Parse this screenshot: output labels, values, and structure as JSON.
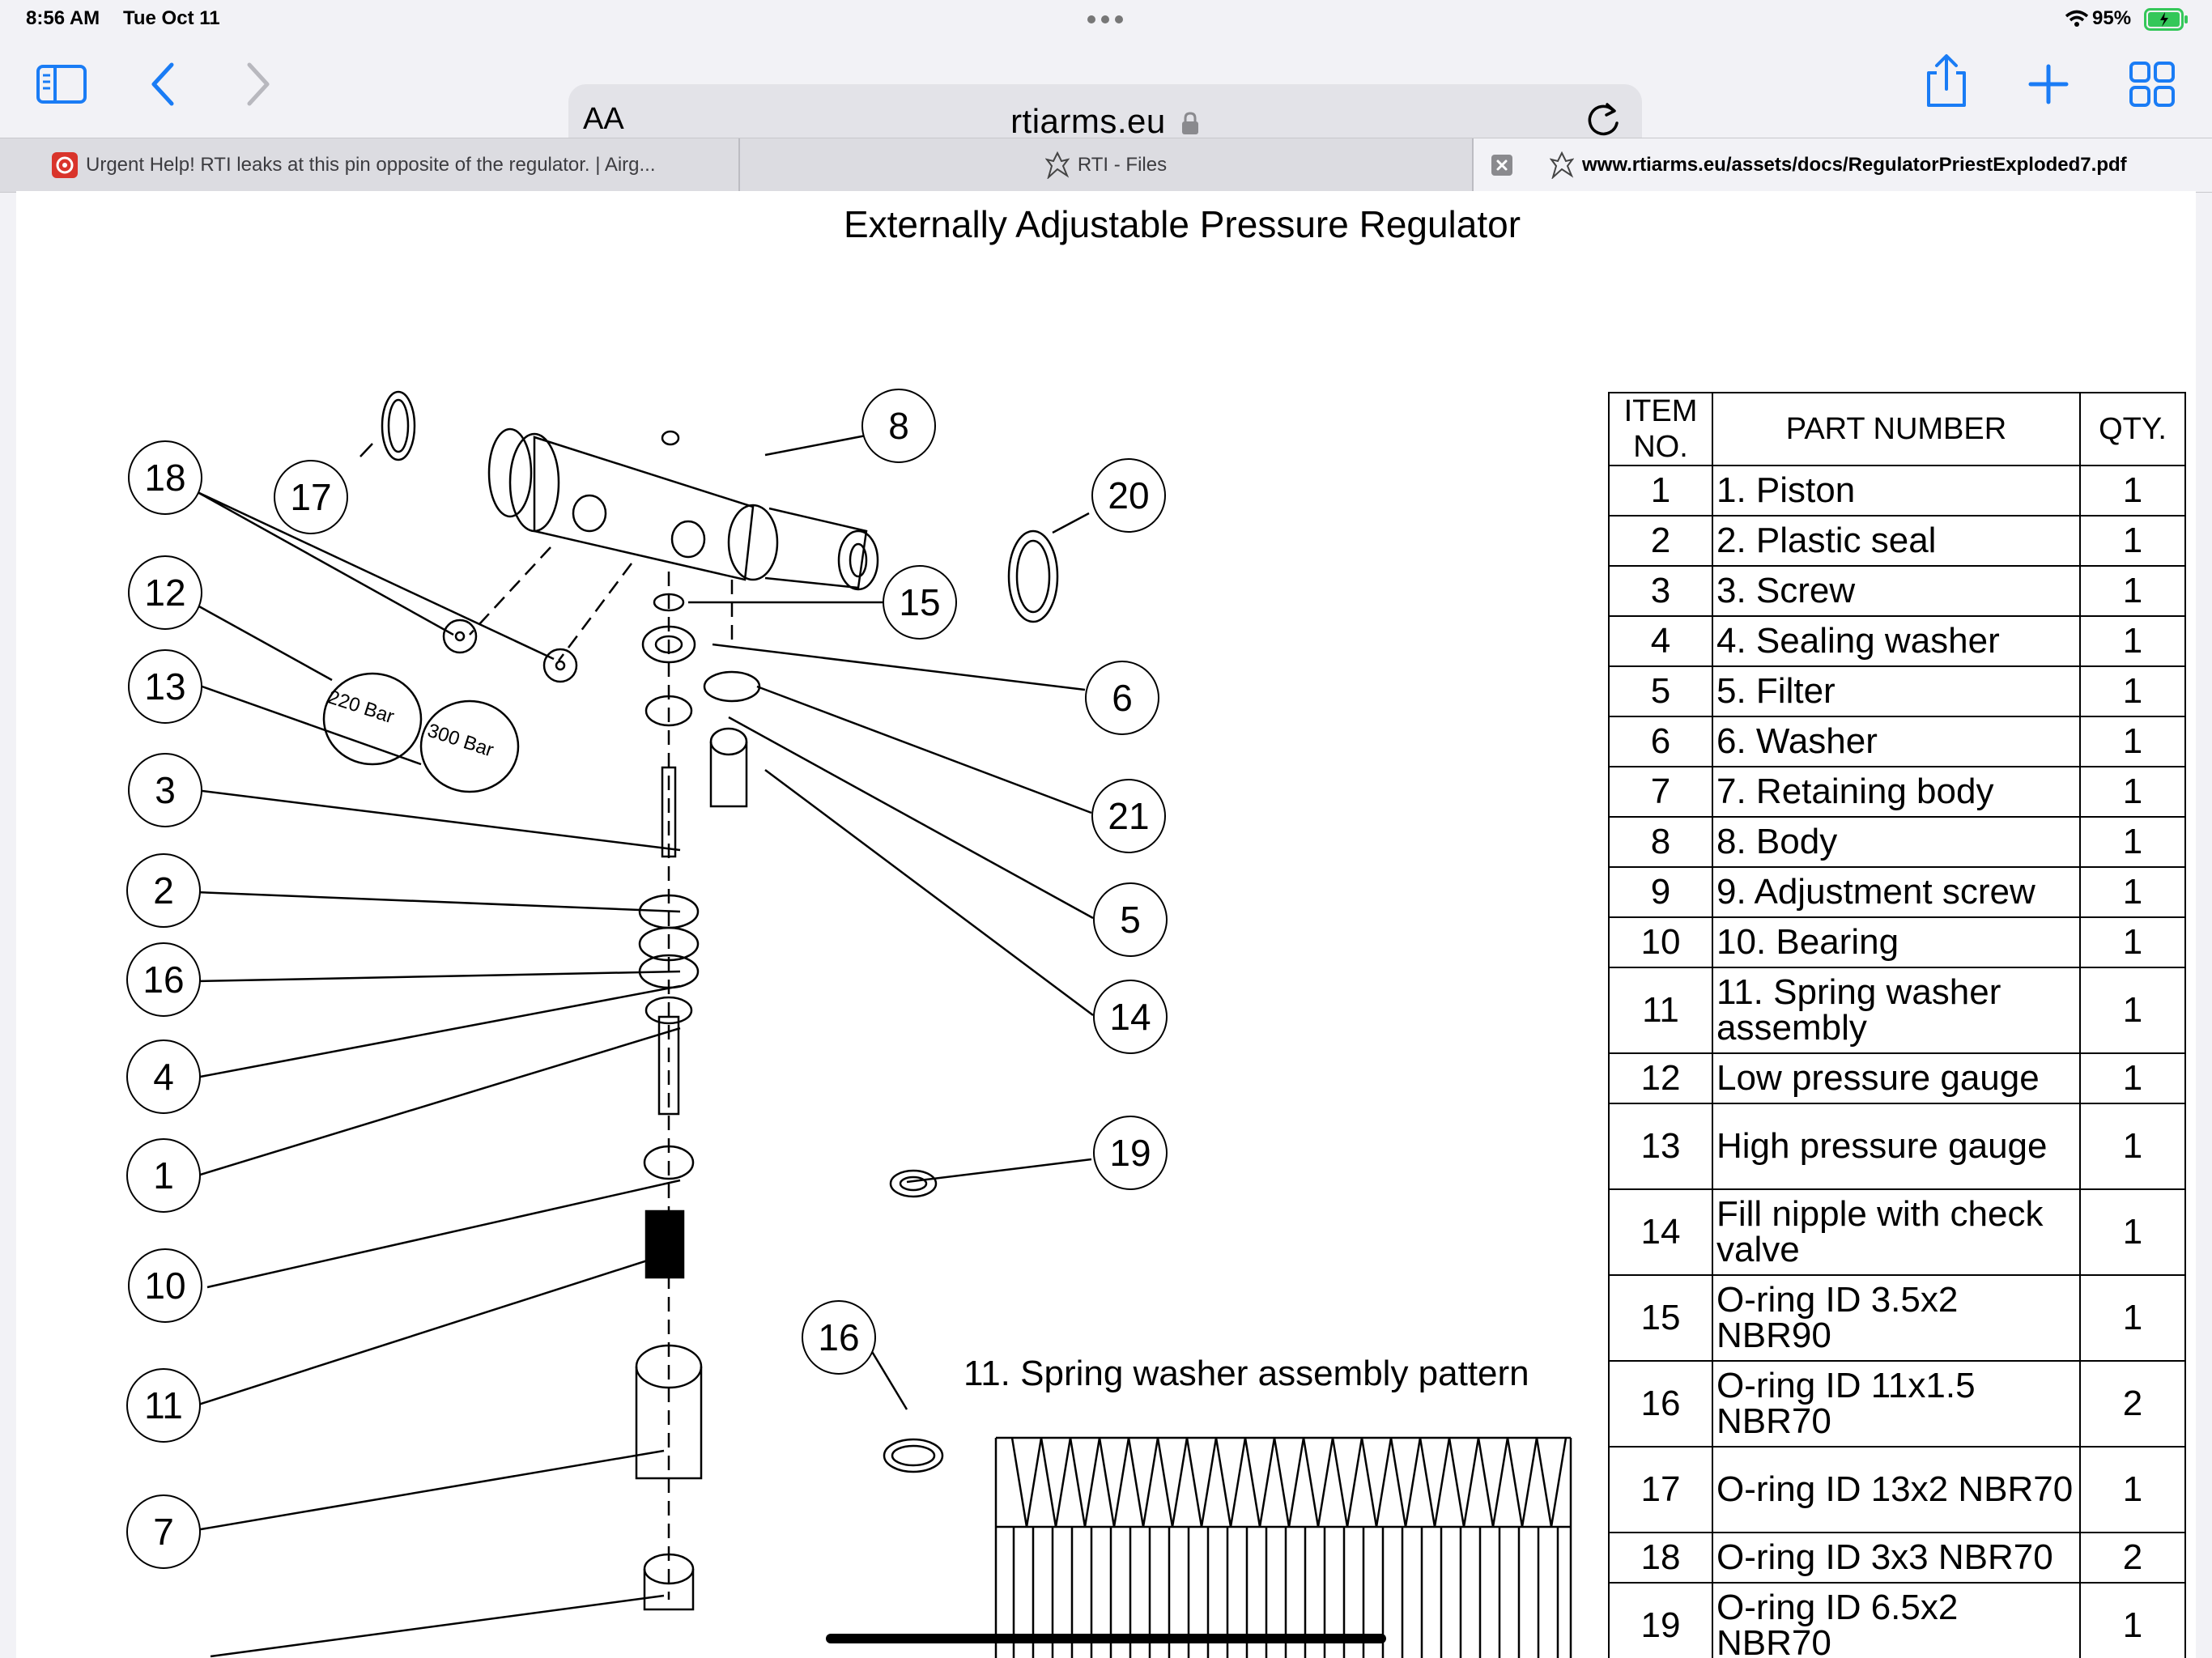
{
  "status_bar": {
    "time": "8:56 AM",
    "date": "Tue Oct 11",
    "battery": "95%"
  },
  "toolbar": {
    "text_size_label": "AA",
    "url": "rtiarms.eu"
  },
  "tabs": [
    {
      "label": "Urgent Help! RTI leaks at this pin opposite of the regulator. | Airg..."
    },
    {
      "label": "RTI - Files"
    },
    {
      "label": "www.rtiarms.eu/assets/docs/RegulatorPriestExploded7.pdf"
    }
  ],
  "document": {
    "title": "Externally Adjustable Pressure Regulator",
    "pattern_title": "11. Spring washer assembly pattern",
    "gauge_labels": [
      "220 Bar",
      "300 Bar"
    ],
    "callouts": [
      "18",
      "17",
      "8",
      "20",
      "12",
      "15",
      "13",
      "6",
      "3",
      "21",
      "2",
      "5",
      "16",
      "14",
      "4",
      "1",
      "19",
      "10",
      "16",
      "11",
      "7"
    ],
    "table": {
      "headers": {
        "item_no": "ITEM NO.",
        "part_number": "PART NUMBER",
        "qty": "QTY."
      },
      "rows": [
        {
          "item": "1",
          "part": "1. Piston",
          "qty": "1"
        },
        {
          "item": "2",
          "part": "2. Plastic seal",
          "qty": "1"
        },
        {
          "item": "3",
          "part": "3. Screw",
          "qty": "1"
        },
        {
          "item": "4",
          "part": "4. Sealing washer",
          "qty": "1"
        },
        {
          "item": "5",
          "part": "5. Filter",
          "qty": "1"
        },
        {
          "item": "6",
          "part": "6. Washer",
          "qty": "1"
        },
        {
          "item": "7",
          "part": "7. Retaining body",
          "qty": "1"
        },
        {
          "item": "8",
          "part": "8. Body",
          "qty": "1"
        },
        {
          "item": "9",
          "part": "9. Adjustment screw",
          "qty": "1"
        },
        {
          "item": "10",
          "part": "10. Bearing",
          "qty": "1"
        },
        {
          "item": "11",
          "part": "11. Spring washer assembly",
          "qty": "1"
        },
        {
          "item": "12",
          "part": "Low pressure gauge",
          "qty": "1"
        },
        {
          "item": "13",
          "part": "High pressure gauge",
          "qty": "1"
        },
        {
          "item": "14",
          "part": "Fill nipple with check valve",
          "qty": "1"
        },
        {
          "item": "15",
          "part": "O-ring ID 3.5x2 NBR90",
          "qty": "1"
        },
        {
          "item": "16",
          "part": "O-ring ID 11x1.5 NBR70",
          "qty": "2"
        },
        {
          "item": "17",
          "part": "O-ring ID 13x2 NBR70",
          "qty": "1"
        },
        {
          "item": "18",
          "part": "O-ring ID 3x3 NBR70",
          "qty": "2"
        },
        {
          "item": "19",
          "part": "O-ring ID 6.5x2 NBR70",
          "qty": "1"
        }
      ]
    }
  },
  "icons": {
    "sidebar": "sidebar-icon",
    "back": "chevron-left-icon",
    "forward": "chevron-right-icon",
    "lock": "lock-icon",
    "reload": "reload-icon",
    "share": "share-icon",
    "new_tab": "plus-icon",
    "tab_overview": "tabs-grid-icon"
  },
  "colors": {
    "accent": "#1a7cf5",
    "battery": "#34c759",
    "favicon_red": "#d9342b"
  }
}
